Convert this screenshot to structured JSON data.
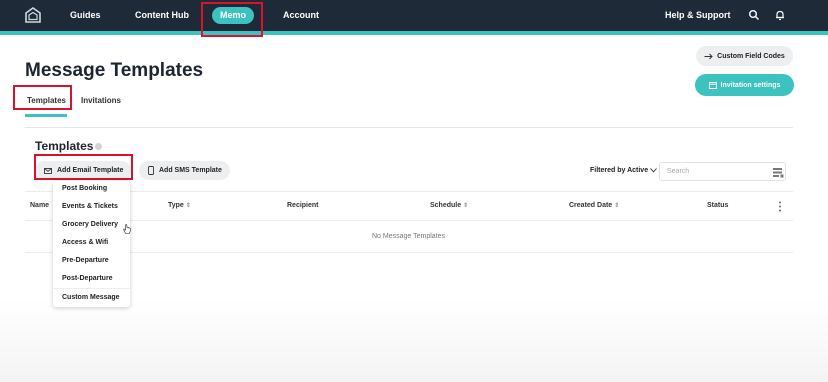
{
  "nav": {
    "items": [
      {
        "label": "Guides",
        "active": false
      },
      {
        "label": "Content Hub",
        "active": false
      },
      {
        "label": "Memo",
        "active": true
      },
      {
        "label": "Account",
        "active": false
      }
    ],
    "help_label": "Help & Support",
    "icons": [
      "search-icon",
      "bell-icon"
    ]
  },
  "page": {
    "title": "Message Templates",
    "tabs": [
      {
        "label": "Templates",
        "active": true
      },
      {
        "label": "Invitations",
        "active": false
      }
    ]
  },
  "actions": {
    "custom_field_codes": "Custom Field Codes",
    "invitation_settings": "Invitation settings"
  },
  "section": {
    "title": "Templates",
    "add_email": "Add Email Template",
    "add_sms": "Add SMS Template",
    "filter_label": "Filtered by Active",
    "search_placeholder": "Search"
  },
  "table": {
    "columns": [
      "Name",
      "Type",
      "Recipient",
      "Schedule",
      "Created Date",
      "Status"
    ],
    "empty_message": "No Message Templates"
  },
  "dropdown": {
    "items": [
      "Post Booking",
      "Events & Tickets",
      "Grocery Delivery",
      "Access & Wifi",
      "Pre-Departure",
      "Post-Departure",
      "Custom Message"
    ],
    "hovered": "Grocery Delivery"
  },
  "colors": {
    "topbar": "#1e2a38",
    "accent": "#3cc2bf",
    "highlight_box": "#d6142b"
  }
}
